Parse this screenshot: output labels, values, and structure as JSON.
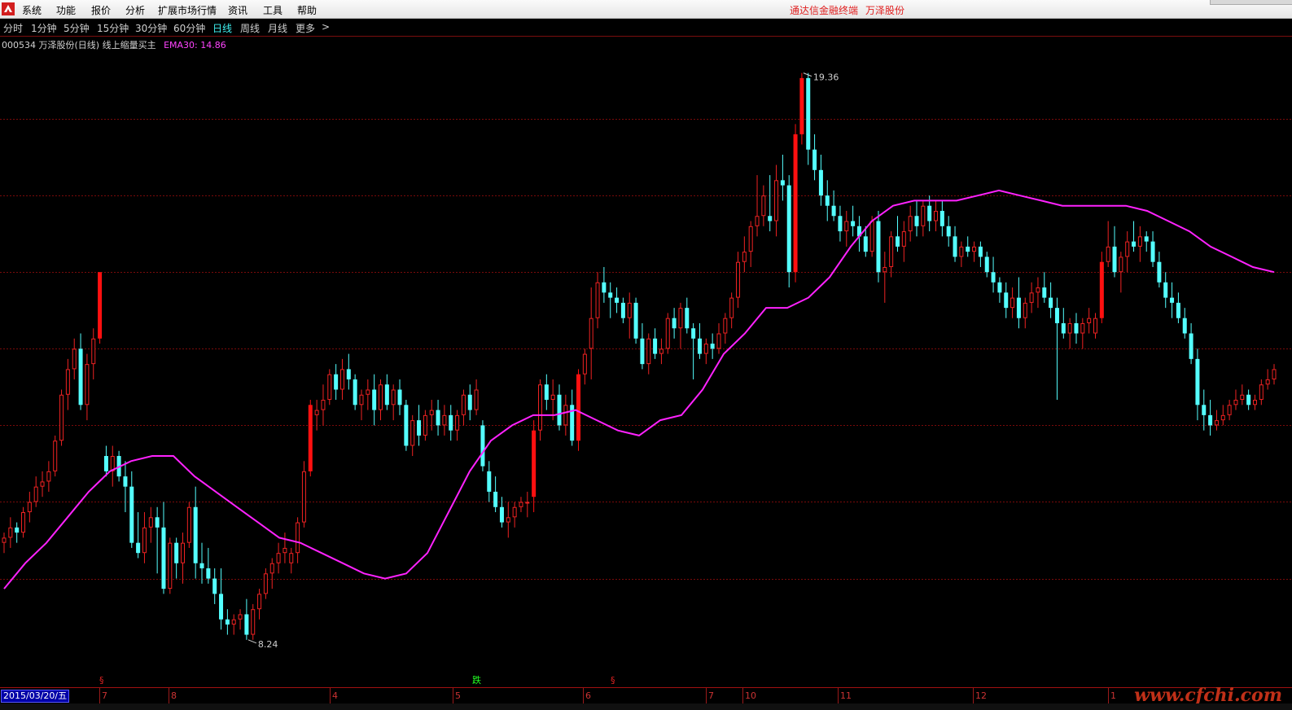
{
  "menu": {
    "items": [
      "系统",
      "功能",
      "报价",
      "分析",
      "扩展市场行情",
      "资讯",
      "工具",
      "帮助"
    ],
    "brand": "通达信金融终端",
    "stock_name": "万泽股份"
  },
  "periods": {
    "items": [
      "分时",
      "1分钟",
      "5分钟",
      "15分钟",
      "30分钟",
      "60分钟",
      "日线",
      "周线",
      "月线",
      "更多"
    ],
    "active": "日线",
    "more_arrow": ">"
  },
  "info": {
    "title": "000534 万泽股份(日线) 线上缩量买主",
    "ema_label": "EMA30: 14.86"
  },
  "axis": {
    "start_date": "2015/03/20/五",
    "months": [
      "7",
      "8",
      "4",
      "5",
      "6",
      "7",
      "10",
      "11",
      "12",
      "1"
    ]
  },
  "annotations": {
    "high_label": "19.36",
    "low_label": "8.24",
    "marker_s": "§",
    "marker_drop": "跌"
  },
  "watermark": "www.cfchi.com",
  "colors": {
    "up": "#ee2222",
    "down": "#54ffff",
    "ema": "#ff22ff",
    "signal_yellow": "#ffb000",
    "signal_green": "#22dd22",
    "grid": "#7a0a0a"
  },
  "chart_data": {
    "type": "candlestick",
    "ylim": [
      7.5,
      20.0
    ],
    "grid_levels": [
      9.5,
      11.0,
      12.5,
      14.0,
      15.5,
      17.0,
      18.5
    ],
    "candles": [
      [
        10.2,
        10.4,
        10.0,
        10.3
      ],
      [
        10.3,
        10.7,
        10.1,
        10.5
      ],
      [
        10.5,
        10.6,
        10.2,
        10.4
      ],
      [
        10.4,
        10.9,
        10.3,
        10.8
      ],
      [
        10.8,
        11.2,
        10.6,
        11.0
      ],
      [
        11.0,
        11.5,
        10.9,
        11.3
      ],
      [
        11.3,
        11.6,
        11.1,
        11.4
      ],
      [
        11.4,
        11.8,
        11.2,
        11.6
      ],
      [
        11.6,
        12.3,
        11.5,
        12.2
      ],
      [
        12.2,
        13.2,
        12.1,
        13.1
      ],
      [
        13.1,
        13.8,
        12.8,
        13.6
      ],
      [
        13.6,
        14.2,
        13.4,
        14.0
      ],
      [
        14.0,
        14.3,
        12.8,
        12.9
      ],
      [
        12.9,
        13.9,
        12.6,
        13.7
      ],
      [
        13.7,
        14.4,
        13.4,
        14.2
      ],
      [
        14.2,
        15.5,
        14.1,
        15.5
      ],
      [
        11.9,
        12.1,
        11.5,
        11.6
      ],
      [
        11.6,
        12.1,
        11.3,
        11.9
      ],
      [
        11.9,
        12.0,
        11.4,
        11.5
      ],
      [
        11.5,
        11.8,
        10.8,
        11.3
      ],
      [
        11.3,
        11.6,
        10.1,
        10.2
      ],
      [
        10.2,
        10.8,
        9.9,
        10.0
      ],
      [
        10.0,
        10.8,
        9.8,
        10.5
      ],
      [
        10.5,
        10.9,
        10.2,
        10.7
      ],
      [
        10.7,
        10.9,
        9.6,
        10.5
      ],
      [
        10.5,
        11.0,
        9.2,
        9.3
      ],
      [
        9.3,
        10.3,
        9.2,
        10.2
      ],
      [
        10.2,
        10.3,
        9.5,
        9.8
      ],
      [
        9.8,
        10.4,
        9.4,
        10.2
      ],
      [
        10.2,
        11.0,
        10.1,
        10.9
      ],
      [
        10.9,
        11.3,
        9.5,
        9.8
      ],
      [
        9.8,
        10.2,
        9.4,
        9.7
      ],
      [
        9.7,
        10.1,
        9.4,
        9.5
      ],
      [
        9.5,
        9.7,
        9.0,
        9.2
      ],
      [
        9.2,
        9.7,
        8.5,
        8.7
      ],
      [
        8.7,
        8.9,
        8.4,
        8.6
      ],
      [
        8.6,
        8.8,
        8.4,
        8.7
      ],
      [
        8.7,
        8.9,
        8.5,
        8.8
      ],
      [
        8.8,
        9.1,
        8.3,
        8.4
      ],
      [
        8.4,
        9.0,
        8.3,
        8.9
      ],
      [
        8.9,
        9.3,
        8.7,
        9.2
      ],
      [
        9.2,
        9.7,
        9.1,
        9.6
      ],
      [
        9.6,
        9.9,
        9.3,
        9.8
      ],
      [
        9.8,
        10.2,
        9.6,
        10.0
      ],
      [
        10.0,
        10.4,
        9.8,
        10.1
      ],
      [
        9.8,
        10.1,
        9.6,
        10.0
      ],
      [
        10.0,
        10.7,
        9.8,
        10.6
      ],
      [
        10.6,
        11.8,
        10.5,
        11.6
      ],
      [
        11.6,
        13.0,
        11.5,
        12.9
      ],
      [
        12.7,
        13.0,
        12.4,
        12.8
      ],
      [
        12.8,
        13.3,
        12.5,
        13.0
      ],
      [
        13.0,
        13.6,
        12.9,
        13.5
      ],
      [
        13.5,
        13.7,
        13.0,
        13.2
      ],
      [
        13.2,
        13.8,
        13.0,
        13.6
      ],
      [
        13.6,
        13.9,
        13.2,
        13.4
      ],
      [
        13.4,
        13.5,
        12.8,
        12.9
      ],
      [
        12.9,
        13.2,
        12.6,
        13.1
      ],
      [
        13.1,
        13.4,
        12.8,
        13.2
      ],
      [
        13.2,
        13.5,
        12.5,
        12.8
      ],
      [
        12.8,
        13.4,
        12.6,
        13.3
      ],
      [
        13.3,
        13.5,
        12.8,
        12.9
      ],
      [
        12.9,
        13.3,
        12.6,
        13.2
      ],
      [
        13.2,
        13.4,
        12.7,
        12.9
      ],
      [
        12.9,
        13.0,
        12.0,
        12.1
      ],
      [
        12.1,
        12.7,
        11.9,
        12.6
      ],
      [
        12.6,
        12.9,
        12.1,
        12.3
      ],
      [
        12.3,
        12.8,
        12.2,
        12.7
      ],
      [
        12.7,
        13.0,
        12.4,
        12.8
      ],
      [
        12.8,
        13.0,
        12.3,
        12.5
      ],
      [
        12.5,
        12.9,
        12.3,
        12.7
      ],
      [
        12.7,
        12.9,
        12.2,
        12.4
      ],
      [
        12.4,
        12.8,
        12.2,
        12.7
      ],
      [
        12.7,
        13.2,
        12.5,
        13.1
      ],
      [
        13.1,
        13.3,
        12.6,
        12.8
      ],
      [
        12.8,
        13.4,
        12.7,
        13.2
      ],
      [
        12.5,
        12.6,
        11.6,
        11.7
      ],
      [
        11.6,
        11.8,
        11.0,
        11.2
      ],
      [
        11.2,
        11.5,
        10.8,
        10.9
      ],
      [
        10.9,
        11.1,
        10.5,
        10.6
      ],
      [
        10.6,
        11.0,
        10.3,
        10.7
      ],
      [
        10.7,
        11.0,
        10.5,
        10.9
      ],
      [
        10.9,
        11.1,
        10.8,
        11.0
      ],
      [
        11.0,
        11.2,
        10.7,
        11.0
      ],
      [
        11.1,
        12.6,
        10.8,
        12.4
      ],
      [
        12.4,
        13.4,
        12.2,
        13.3
      ],
      [
        13.3,
        13.5,
        12.8,
        13.0
      ],
      [
        13.0,
        13.4,
        12.6,
        13.1
      ],
      [
        13.1,
        13.3,
        12.4,
        12.5
      ],
      [
        12.5,
        13.1,
        12.3,
        12.9
      ],
      [
        12.9,
        13.2,
        12.1,
        12.2
      ],
      [
        12.2,
        13.6,
        12.0,
        13.5
      ],
      [
        13.5,
        14.0,
        13.3,
        13.9
      ],
      [
        14.0,
        15.2,
        13.4,
        14.6
      ],
      [
        14.6,
        15.5,
        14.4,
        15.3
      ],
      [
        15.3,
        15.6,
        14.9,
        15.1
      ],
      [
        15.1,
        15.3,
        14.6,
        15.0
      ],
      [
        15.0,
        15.2,
        14.7,
        14.9
      ],
      [
        14.9,
        15.0,
        14.5,
        14.6
      ],
      [
        14.6,
        15.1,
        14.2,
        14.9
      ],
      [
        14.9,
        15.0,
        14.1,
        14.2
      ],
      [
        14.2,
        14.5,
        13.6,
        13.7
      ],
      [
        13.7,
        14.3,
        13.5,
        14.2
      ],
      [
        14.2,
        14.4,
        13.8,
        13.9
      ],
      [
        13.9,
        14.2,
        13.7,
        14.0
      ],
      [
        14.0,
        14.7,
        13.9,
        14.6
      ],
      [
        14.6,
        14.8,
        14.2,
        14.4
      ],
      [
        14.4,
        14.9,
        14.0,
        14.8
      ],
      [
        14.8,
        15.0,
        14.3,
        14.4
      ],
      [
        14.4,
        14.5,
        13.4,
        14.2
      ],
      [
        14.2,
        14.5,
        13.8,
        13.9
      ],
      [
        13.9,
        14.2,
        13.7,
        14.1
      ],
      [
        14.1,
        14.3,
        13.8,
        14.0
      ],
      [
        14.0,
        14.5,
        13.9,
        14.3
      ],
      [
        14.3,
        14.7,
        14.1,
        14.6
      ],
      [
        14.6,
        15.1,
        14.4,
        15.0
      ],
      [
        15.0,
        15.9,
        14.8,
        15.7
      ],
      [
        15.7,
        16.2,
        15.5,
        15.9
      ],
      [
        15.9,
        16.5,
        15.6,
        16.4
      ],
      [
        16.4,
        17.4,
        16.2,
        16.6
      ],
      [
        16.6,
        17.2,
        16.4,
        17.0
      ],
      [
        16.6,
        17.4,
        16.3,
        16.5
      ],
      [
        16.5,
        17.6,
        16.2,
        17.3
      ],
      [
        17.3,
        17.8,
        16.9,
        17.2
      ],
      [
        17.2,
        17.4,
        15.2,
        15.5
      ],
      [
        15.5,
        18.4,
        15.3,
        18.2
      ],
      [
        18.2,
        19.4,
        18.0,
        19.3
      ],
      [
        19.3,
        19.4,
        17.6,
        17.9
      ],
      [
        17.9,
        18.2,
        17.3,
        17.5
      ],
      [
        17.5,
        17.8,
        16.8,
        17.0
      ],
      [
        17.0,
        17.3,
        16.5,
        16.8
      ],
      [
        16.8,
        17.1,
        16.5,
        16.6
      ],
      [
        16.6,
        16.8,
        16.1,
        16.3
      ],
      [
        16.3,
        16.7,
        16.0,
        16.5
      ],
      [
        16.5,
        16.8,
        16.2,
        16.4
      ],
      [
        16.4,
        16.6,
        15.9,
        16.2
      ],
      [
        16.2,
        16.4,
        15.8,
        15.9
      ],
      [
        15.9,
        16.6,
        15.8,
        16.5
      ],
      [
        16.5,
        16.7,
        15.3,
        15.5
      ],
      [
        15.5,
        15.9,
        14.9,
        15.6
      ],
      [
        15.6,
        16.3,
        15.4,
        16.2
      ],
      [
        16.2,
        16.6,
        15.9,
        16.0
      ],
      [
        16.0,
        16.5,
        15.7,
        16.3
      ],
      [
        16.3,
        16.8,
        16.1,
        16.6
      ],
      [
        16.6,
        16.9,
        16.2,
        16.4
      ],
      [
        16.4,
        16.9,
        16.2,
        16.8
      ],
      [
        16.8,
        17.0,
        16.3,
        16.5
      ],
      [
        16.5,
        16.9,
        16.3,
        16.7
      ],
      [
        16.7,
        16.9,
        16.2,
        16.4
      ],
      [
        16.4,
        16.6,
        16.0,
        16.2
      ],
      [
        16.2,
        16.4,
        15.7,
        15.8
      ],
      [
        15.8,
        16.1,
        15.6,
        16.0
      ],
      [
        16.0,
        16.2,
        15.8,
        15.9
      ],
      [
        15.9,
        16.1,
        15.7,
        16.0
      ],
      [
        16.0,
        16.1,
        15.6,
        15.8
      ],
      [
        15.8,
        15.9,
        15.4,
        15.5
      ],
      [
        15.5,
        15.8,
        15.1,
        15.3
      ],
      [
        15.3,
        15.4,
        14.9,
        15.1
      ],
      [
        15.1,
        15.3,
        14.6,
        14.8
      ],
      [
        14.8,
        15.2,
        14.6,
        15.0
      ],
      [
        15.0,
        15.4,
        14.4,
        14.6
      ],
      [
        14.6,
        15.0,
        14.4,
        14.9
      ],
      [
        14.9,
        15.3,
        14.7,
        15.1
      ],
      [
        15.1,
        15.4,
        14.8,
        15.2
      ],
      [
        15.2,
        15.5,
        14.9,
        15.0
      ],
      [
        15.0,
        15.3,
        14.6,
        14.8
      ],
      [
        14.8,
        15.0,
        13.0,
        14.5
      ],
      [
        14.5,
        14.8,
        14.2,
        14.3
      ],
      [
        14.3,
        14.6,
        14.0,
        14.5
      ],
      [
        14.5,
        14.7,
        14.1,
        14.3
      ],
      [
        14.3,
        14.6,
        14.0,
        14.5
      ],
      [
        14.5,
        14.8,
        14.3,
        14.6
      ],
      [
        14.3,
        14.7,
        14.2,
        14.6
      ],
      [
        14.6,
        15.9,
        14.5,
        15.7
      ],
      [
        15.7,
        16.5,
        15.6,
        16.0
      ],
      [
        16.0,
        16.4,
        15.4,
        15.5
      ],
      [
        15.5,
        15.9,
        15.1,
        15.8
      ],
      [
        15.8,
        16.3,
        15.5,
        16.1
      ],
      [
        16.1,
        16.5,
        15.9,
        16.0
      ],
      [
        16.0,
        16.4,
        15.7,
        16.2
      ],
      [
        16.2,
        16.3,
        15.9,
        16.1
      ],
      [
        16.1,
        16.3,
        15.6,
        15.7
      ],
      [
        15.7,
        15.9,
        15.2,
        15.3
      ],
      [
        15.3,
        15.5,
        14.8,
        15.0
      ],
      [
        15.0,
        15.3,
        14.6,
        14.9
      ],
      [
        14.9,
        15.1,
        14.5,
        14.6
      ],
      [
        14.6,
        14.8,
        14.2,
        14.3
      ],
      [
        14.3,
        14.5,
        13.7,
        13.8
      ],
      [
        13.8,
        14.0,
        12.6,
        12.9
      ],
      [
        12.9,
        13.2,
        12.4,
        12.7
      ],
      [
        12.7,
        13.0,
        12.3,
        12.5
      ],
      [
        12.5,
        12.8,
        12.4,
        12.6
      ],
      [
        12.6,
        12.9,
        12.5,
        12.7
      ],
      [
        12.7,
        13.0,
        12.6,
        12.9
      ],
      [
        12.9,
        13.2,
        12.8,
        13.0
      ],
      [
        13.0,
        13.3,
        12.9,
        13.1
      ],
      [
        13.1,
        13.2,
        12.8,
        12.9
      ],
      [
        12.9,
        13.1,
        12.8,
        13.0
      ],
      [
        13.0,
        13.4,
        12.9,
        13.3
      ],
      [
        13.3,
        13.6,
        13.2,
        13.4
      ],
      [
        13.4,
        13.7,
        13.3,
        13.6
      ]
    ],
    "ema30": [
      9.3,
      9.8,
      10.2,
      10.7,
      11.2,
      11.6,
      11.8,
      11.9,
      11.9,
      11.5,
      11.2,
      10.9,
      10.6,
      10.3,
      10.2,
      10.0,
      9.8,
      9.6,
      9.5,
      9.6,
      10.0,
      10.8,
      11.6,
      12.2,
      12.5,
      12.7,
      12.7,
      12.8,
      12.6,
      12.4,
      12.3,
      12.6,
      12.7,
      13.2,
      13.9,
      14.3,
      14.8,
      14.8,
      15.0,
      15.4,
      16.0,
      16.5,
      16.8,
      16.9,
      16.9,
      16.9,
      17.0,
      17.1,
      17.0,
      16.9,
      16.8,
      16.8,
      16.8,
      16.8,
      16.7,
      16.5,
      16.3,
      16.0,
      15.8,
      15.6,
      15.5
    ]
  }
}
